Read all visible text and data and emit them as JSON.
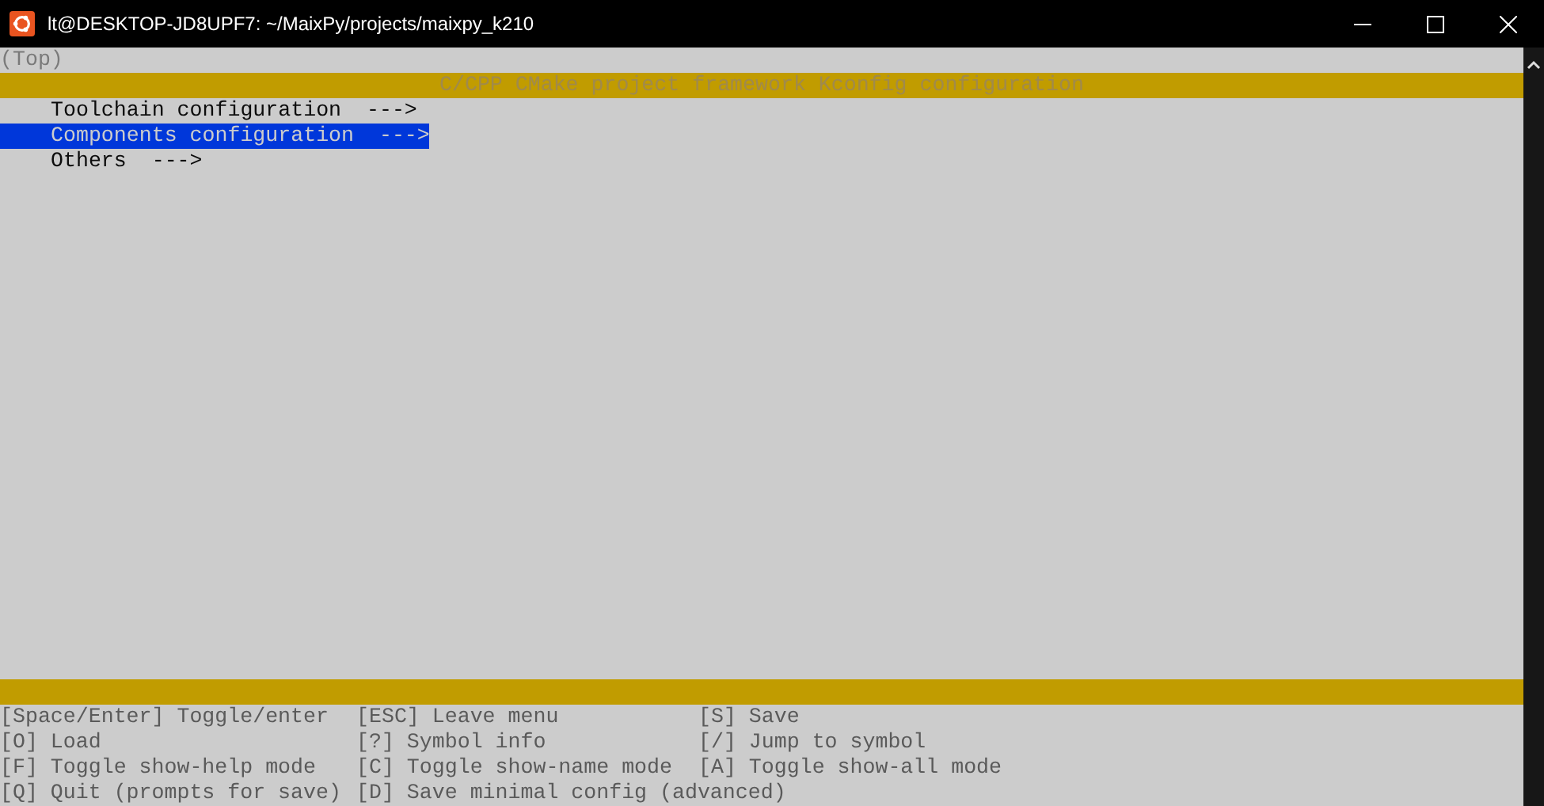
{
  "window": {
    "title": "lt@DESKTOP-JD8UPF7: ~/MaixPy/projects/maixpy_k210"
  },
  "breadcrumb": "(Top)",
  "header": "C/CPP CMake project framework Kconfig configuration",
  "menu": [
    {
      "label": "Toolchain configuration  --->",
      "selected": false
    },
    {
      "label": "Components configuration  --->",
      "selected": true
    },
    {
      "label": "Others  --->",
      "selected": false
    }
  ],
  "help": [
    [
      "[Space/Enter] Toggle/enter",
      "[ESC] Leave menu",
      "[S] Save"
    ],
    [
      "[O] Load",
      "[?] Symbol info",
      "[/] Jump to symbol"
    ],
    [
      "[F] Toggle show-help mode",
      "[C] Toggle show-name mode",
      "[A] Toggle show-all mode"
    ],
    [
      "[Q] Quit (prompts for save)",
      "[D] Save minimal config (advanced)"
    ]
  ]
}
